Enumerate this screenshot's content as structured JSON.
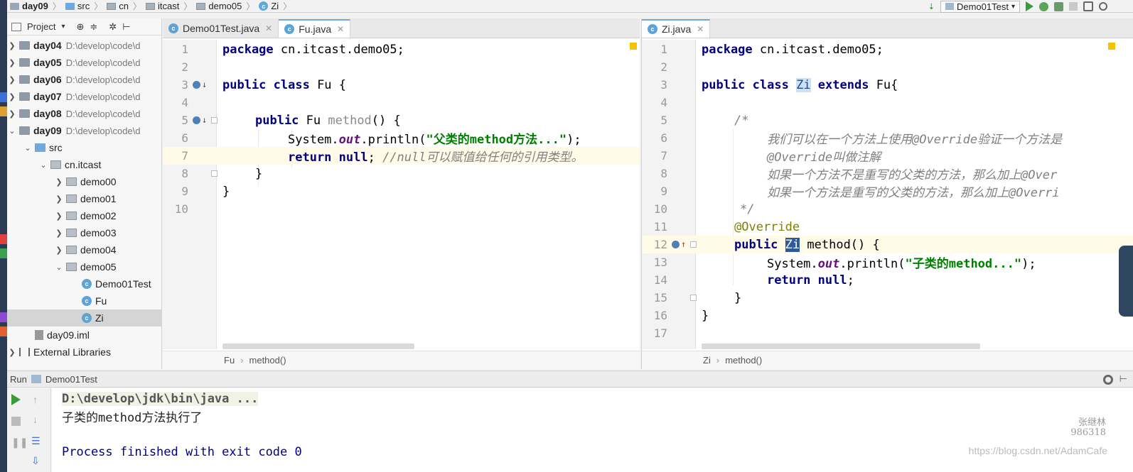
{
  "navbar": {
    "crumbs": [
      "day09",
      "src",
      "cn",
      "itcast",
      "demo05",
      "Zi"
    ],
    "run_config": "Demo01Test"
  },
  "project": {
    "title": "Project",
    "tree": [
      {
        "label": "day04",
        "path": "D:\\develop\\code\\d"
      },
      {
        "label": "day05",
        "path": "D:\\develop\\code\\d"
      },
      {
        "label": "day06",
        "path": "D:\\develop\\code\\d"
      },
      {
        "label": "day07",
        "path": "D:\\develop\\code\\d"
      },
      {
        "label": "day08",
        "path": "D:\\develop\\code\\d"
      },
      {
        "label": "day09",
        "path": "D:\\develop\\code\\d"
      },
      {
        "label": "src"
      },
      {
        "label": "cn.itcast"
      },
      {
        "label": "demo00"
      },
      {
        "label": "demo01"
      },
      {
        "label": "demo02"
      },
      {
        "label": "demo03"
      },
      {
        "label": "demo04"
      },
      {
        "label": "demo05"
      },
      {
        "label": "Demo01Test"
      },
      {
        "label": "Fu"
      },
      {
        "label": "Zi"
      },
      {
        "label": "day09.iml"
      },
      {
        "label": "External Libraries"
      }
    ]
  },
  "left_editor": {
    "tabs": [
      "Demo01Test.java",
      "Fu.java"
    ],
    "line_numbers": [
      "1",
      "2",
      "3",
      "4",
      "5",
      "6",
      "7",
      "8",
      "9",
      "10"
    ],
    "code": {
      "l1_kw": "package",
      "l1_rest": " cn.itcast.demo05;",
      "l3_kw": "public class",
      "l3_rest": " Fu {",
      "l5_kw": "public",
      "l5_type": " Fu",
      "l5_name": " method",
      "l5_rest": "() {",
      "l6_a": "System.",
      "l6_out": "out",
      "l6_b": ".println(",
      "l6_str": "\"父类的method方法...\"",
      "l6_c": ");",
      "l7_kw": "return null",
      "l7_semi": "; ",
      "l7_comment": "//null可以赋值给任何的引用类型。",
      "l8": "}",
      "l9": "}"
    },
    "breadcrumb": [
      "Fu",
      "method()"
    ]
  },
  "right_editor": {
    "tabs": [
      "Zi.java"
    ],
    "line_numbers": [
      "1",
      "2",
      "3",
      "4",
      "5",
      "6",
      "7",
      "8",
      "9",
      "10",
      "11",
      "12",
      "13",
      "14",
      "15",
      "16",
      "17"
    ],
    "code": {
      "l1_kw": "package",
      "l1_rest": " cn.itcast.demo05;",
      "l3_kw": "public class",
      "l3_zi": "Zi",
      "l3_ext": " extends",
      "l3_rest": " Fu{",
      "l5": "/*",
      "l6": "我们可以在一个方法上使用@Override验证一个方法是",
      "l7": "@Override叫做注解",
      "l8": "如果一个方法不是重写的父类的方法，那么加上@Over",
      "l9": "如果一个方法是重写的父类的方法，那么加上@Overri",
      "l10": "*/",
      "l11": "@Override",
      "l12_kw": "public",
      "l12_zi": "Zi",
      "l12_rest": " method() {",
      "l13_a": "System.",
      "l13_out": "out",
      "l13_b": ".println(",
      "l13_str": "\"子类的method...\"",
      "l13_c": ");",
      "l14_kw": "return null",
      "l14_semi": ";",
      "l15": "}",
      "l16": "}"
    },
    "breadcrumb": [
      "Zi",
      "method()"
    ]
  },
  "run": {
    "label": "Run",
    "config": "Demo01Test",
    "output": [
      "D:\\develop\\jdk\\bin\\java ...",
      "子类的method方法执行了",
      "",
      "Process finished with exit code 0"
    ]
  },
  "watermark": {
    "name": "张继林",
    "id": "986318",
    "url": "https://blog.csdn.net/AdamCafe"
  }
}
